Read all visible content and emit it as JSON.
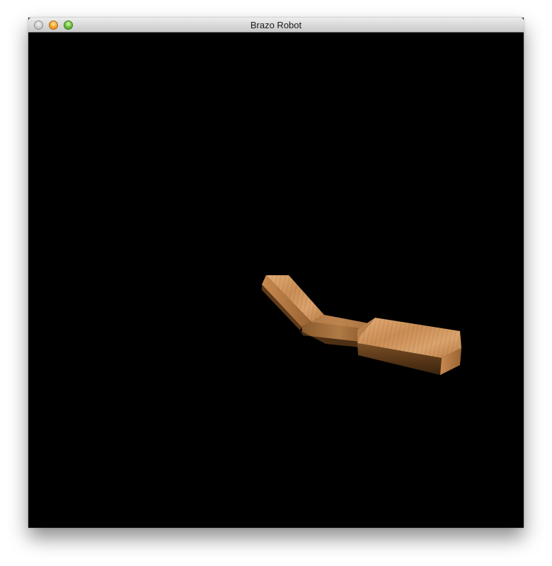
{
  "window": {
    "title": "Brazo Robot"
  },
  "colors": {
    "viewport_background": "#000000",
    "wood_light": "#d8a06a",
    "wood_mid": "#a9743f",
    "wood_dark": "#4a2f14"
  },
  "icons": {
    "close": "close-button-icon",
    "minimize": "minimize-button-icon",
    "zoom": "zoom-button-icon"
  }
}
